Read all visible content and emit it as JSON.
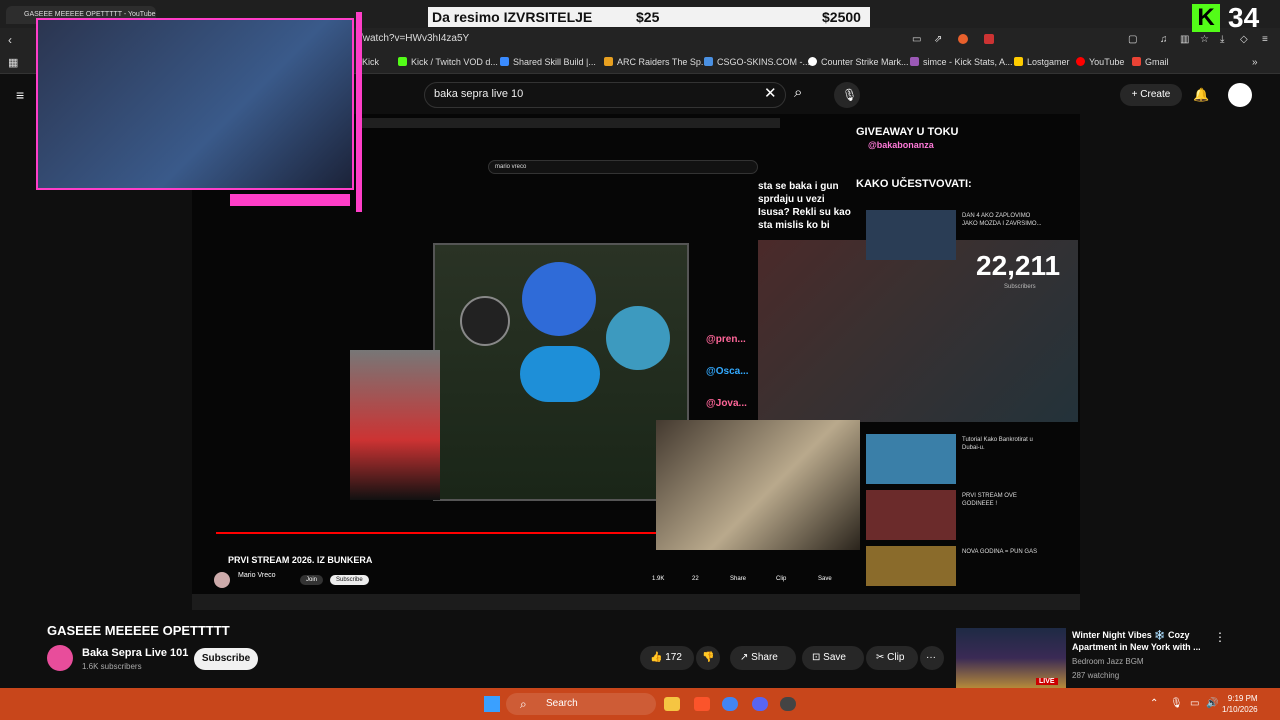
{
  "browser": {
    "active_tab": "GASEEE MEEEEE OPETTTTT - YouTube",
    "url": "/watch?v=HWv3hI4za5Y",
    "bookmarks": [
      {
        "label": "Kick",
        "color": "#53fc18"
      },
      {
        "label": "Kick / Twitch VOD d...",
        "color": "#53fc18"
      },
      {
        "label": "Shared Skill Build |...",
        "color": "#3a8bff"
      },
      {
        "label": "ARC Raiders The Sp...",
        "color": "#e8a020"
      },
      {
        "label": "CSGO-SKINS.COM -...",
        "color": "#4a90e2"
      },
      {
        "label": "Counter Strike Mark...",
        "color": "#ffffff"
      },
      {
        "label": "simce - Kick Stats, A...",
        "color": "#9b59b6"
      },
      {
        "label": "Lostgamer",
        "color": "#ffcc00"
      },
      {
        "label": "YouTube",
        "color": "#ff0000"
      },
      {
        "label": "Gmail",
        "color": "#ea4335"
      }
    ]
  },
  "overlay": {
    "goal_text": "Da resimo IZVRSITELJE",
    "goal_current": "$25",
    "goal_target": "$2500",
    "kick_badge": "K",
    "kick_count": "34"
  },
  "youtube": {
    "search_value": "baka sepra live 10",
    "create_label": "Create"
  },
  "player": {
    "inner_search": "mario vreco",
    "giveaway": "GIVEAWAY U TOKU",
    "giveaway_handle": "@bakabonanza",
    "kako": "KAKO UČESTVOVATI:",
    "subs_count": "22,211",
    "subs_label": "Subscribers",
    "chat_text": "sta se baka i gun sprdaju u vezi Isusa? Rekli su kao sta mislis ko bi",
    "mentions": [
      "@pren...",
      "@Osca...",
      "@Jova..."
    ],
    "related": [
      {
        "title": "DAN 4 AKO ZAPLOVIMO JAKO MOZDA I ZAVRSIMO..."
      },
      {
        "title": "Tutorial Kako Bankrotirat u Dubai-u."
      },
      {
        "title": "PRVI STREAM OVE GODINEEE !"
      },
      {
        "title": "NOVA GODINA = PUN GAS"
      }
    ],
    "inner_title": "PRVI STREAM 2026. IZ BUNKERA",
    "inner_channel": "Mario Vreco",
    "inner_join": "Join",
    "inner_subscribe": "Subscribe",
    "inner_likes": "1.9K",
    "inner_dislikes": "22",
    "inner_share": "Share",
    "inner_clip": "Clip",
    "inner_save": "Save"
  },
  "video": {
    "title": "GASEEE MEEEEE OPETTTTT",
    "channel": "Baka Sepra Live 101",
    "subscribers": "1.6K subscribers",
    "subscribe_label": "Subscribe",
    "likes": "172",
    "share_label": "Share",
    "save_label": "Save",
    "clip_label": "Clip",
    "more_label": "···"
  },
  "recommended": {
    "title": "Winter Night Vibes ❄️ Cozy Apartment in New York with ...",
    "channel": "Bedroom Jazz BGM",
    "watching": "287 watching",
    "live_label": "LIVE"
  },
  "taskbar": {
    "search_label": "Search",
    "time": "9:19 PM",
    "date": "1/10/2026"
  }
}
